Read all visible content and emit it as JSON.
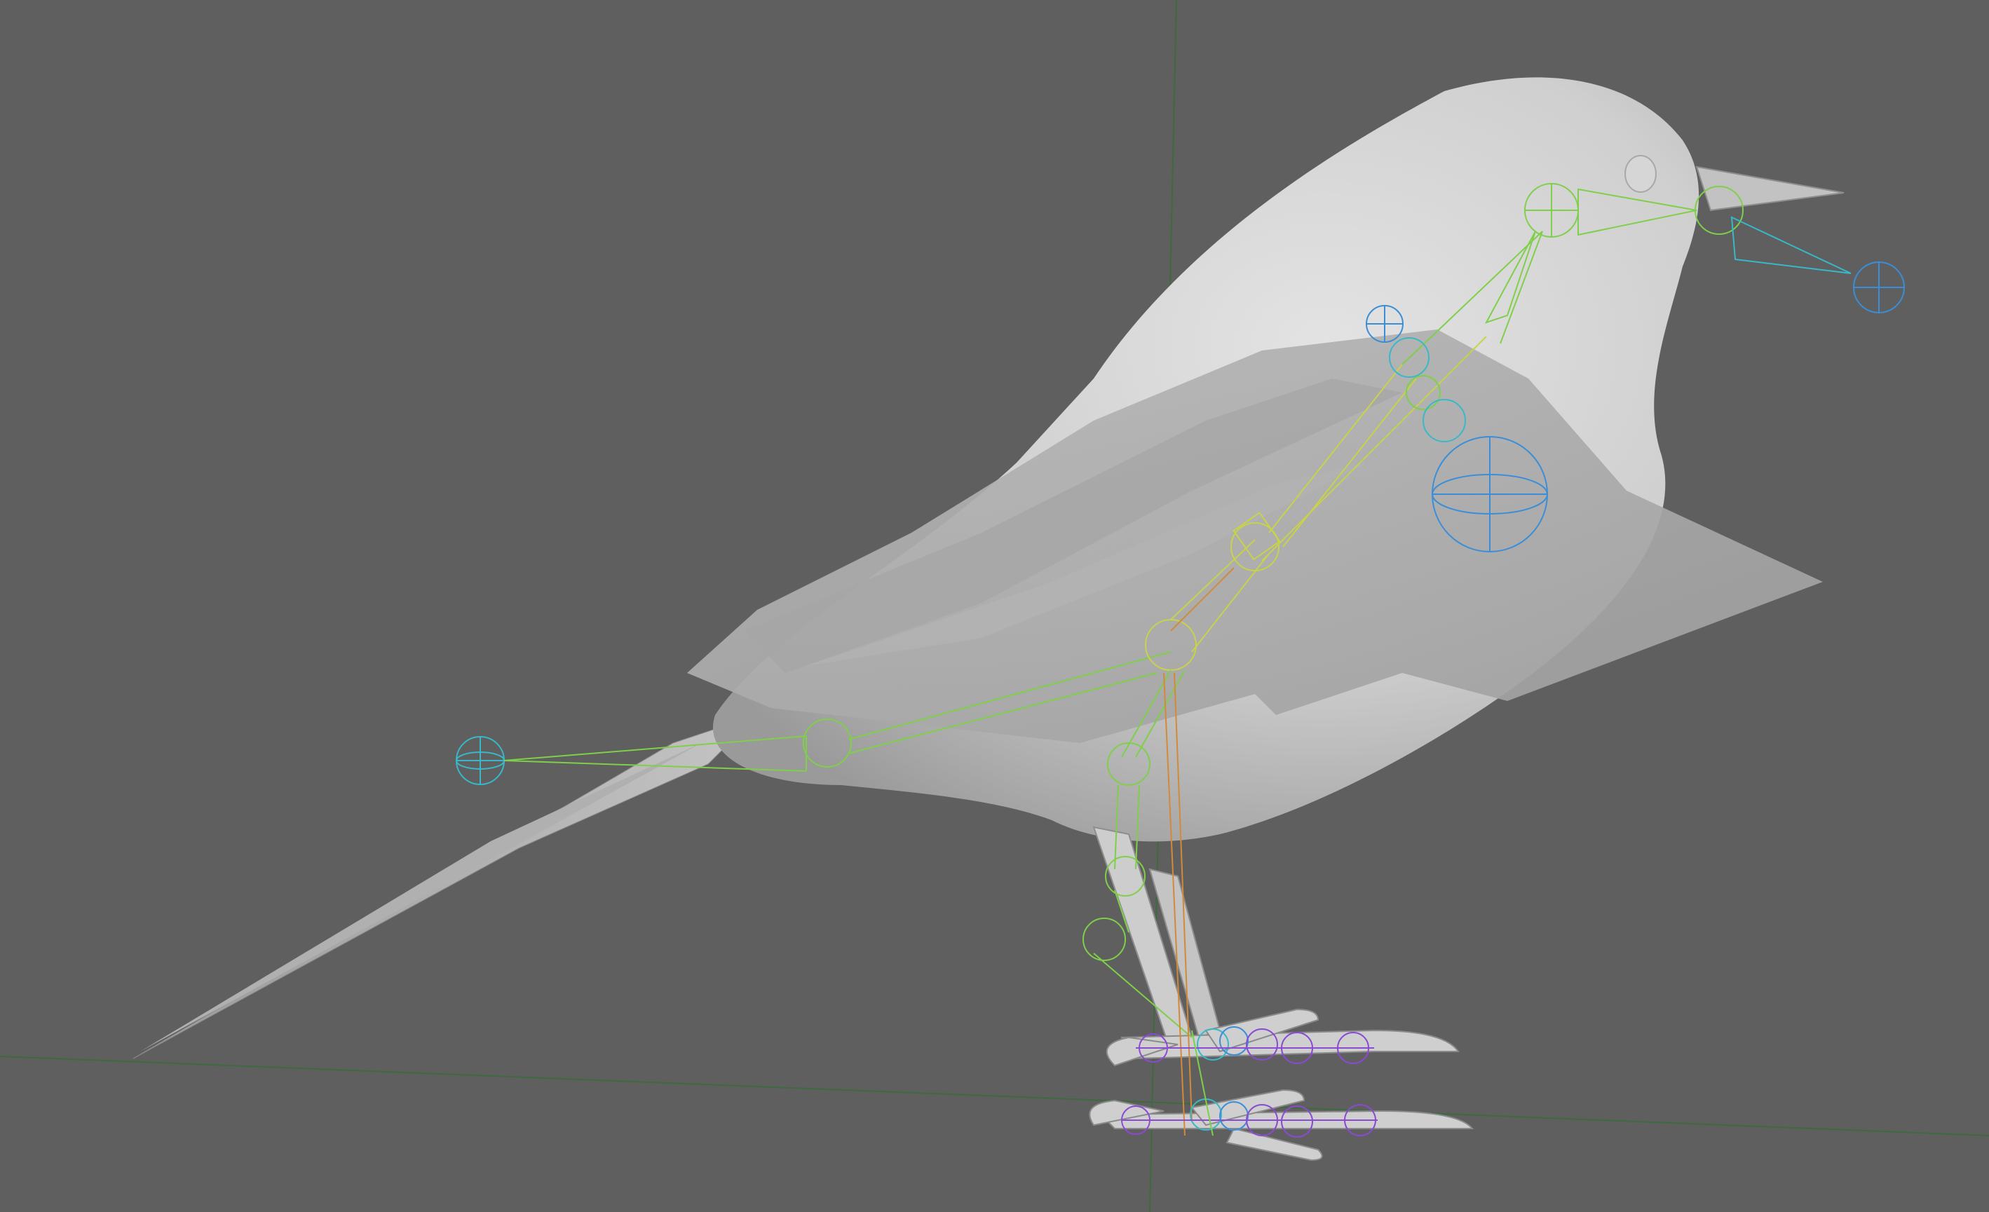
{
  "viewport": {
    "kind": "3d-viewport",
    "background": "#5f5f5f",
    "grid_axis_color": "#3f6a3f"
  },
  "scene": {
    "model": "bird-mesh",
    "mesh_color": "#c9c9c9",
    "rig_visible": true,
    "rig_colors": {
      "spine": "#7fcf4a",
      "joint_yellow": "#c8d24a",
      "control_blue": "#3b8ed6",
      "control_cyan": "#38b8c8",
      "pole_orange": "#d28a3a",
      "toe_purple": "#8a4ad2"
    }
  }
}
